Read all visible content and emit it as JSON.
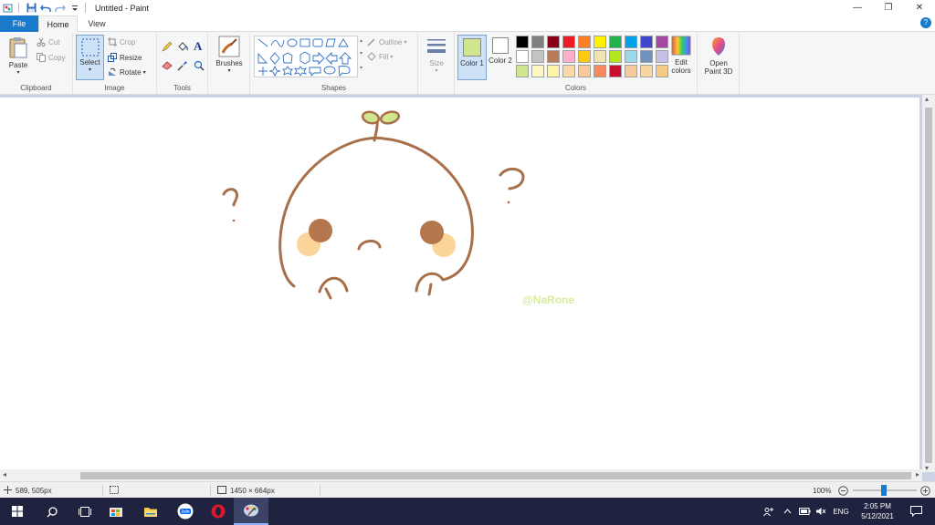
{
  "app": {
    "title": "Untitled - Paint"
  },
  "quick_access": [
    "paint-logo-icon",
    "save-icon",
    "undo-icon",
    "redo-icon",
    "customize-dropdown-icon"
  ],
  "window_controls": {
    "minimize": "—",
    "restore": "❐",
    "close": "✕"
  },
  "tabs": {
    "file": "File",
    "home": "Home",
    "view": "View"
  },
  "help": "?",
  "ribbon": {
    "clipboard": {
      "label": "Clipboard",
      "paste": "Paste",
      "cut": "Cut",
      "copy": "Copy"
    },
    "image": {
      "label": "Image",
      "select": "Select",
      "crop": "Crop",
      "resize": "Resize",
      "rotate": "Rotate"
    },
    "tools": {
      "label": "Tools"
    },
    "brushes": {
      "label": "Brushes"
    },
    "shapes": {
      "label": "Shapes",
      "outline": "Outline",
      "fill": "Fill"
    },
    "size": {
      "label": "Size"
    },
    "colors": {
      "label": "Colors",
      "color1_label": "Color 1",
      "color2_label": "Color 2",
      "color1": "#cfe68f",
      "color2": "#ffffff",
      "edit_colors": "Edit colors",
      "palette_row1": [
        "#000000",
        "#7f7f7f",
        "#880015",
        "#ed1c24",
        "#ff7f27",
        "#fff200",
        "#22b14c",
        "#00a2e8",
        "#3f48cc",
        "#a349a4"
      ],
      "palette_row2": [
        "#ffffff",
        "#c3c3c3",
        "#b97a57",
        "#ffaec9",
        "#ffc90e",
        "#efe4b0",
        "#b5e61d",
        "#99d9ea",
        "#7092be",
        "#c8bfe7"
      ],
      "palette_row3": [
        "#cfe68f",
        "#fdf6c6",
        "#fff5a8",
        "#fcd7a8",
        "#fbc89a",
        "#f58a60",
        "#c8102e",
        "#f6c99d",
        "#f8d6a2",
        "#f6c987",
        "#f3b97c",
        "#f8d9a4"
      ]
    },
    "paint3d": {
      "label": "Open Paint 3D"
    }
  },
  "canvas": {
    "signature": "@NaRone",
    "drawing_color": "#a8704a",
    "sprout_color": "#cfe68f",
    "cheek_color": "#fbd49a",
    "eye_color": "#b4764d"
  },
  "status": {
    "cursor_pos": "589, 505px",
    "canvas_size": "1450 × 664px",
    "zoom": "100%"
  },
  "taskbar": {
    "time": "2:05 PM",
    "date": "5/12/2021",
    "language": "ENG",
    "apps": [
      "windows-start-icon",
      "search-icon",
      "task-view-icon",
      "store-icon",
      "file-explorer-icon",
      "zalo-icon",
      "opera-icon",
      "paint-icon"
    ]
  }
}
